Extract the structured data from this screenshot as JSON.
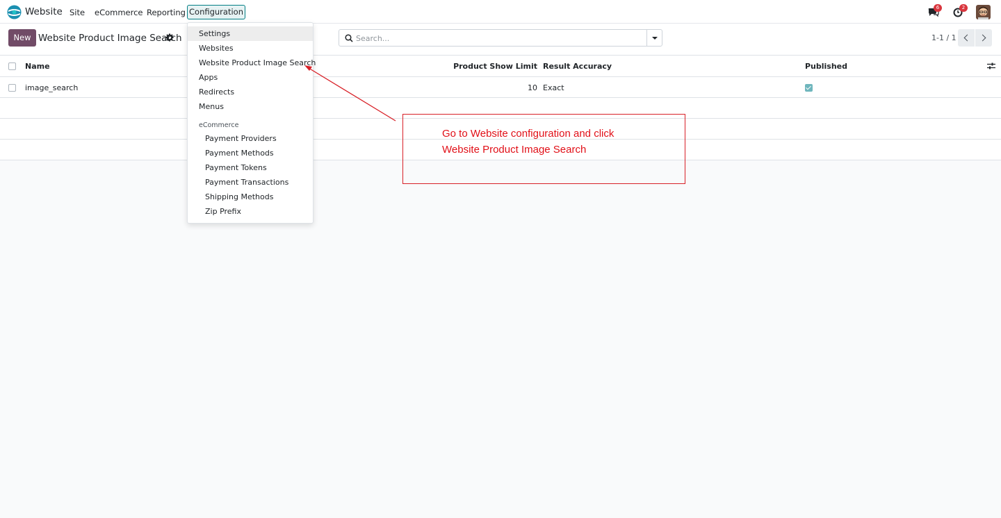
{
  "navbar": {
    "app_name": "Website",
    "menu": [
      "Site",
      "eCommerce",
      "Reporting"
    ],
    "config_label": "Configuration",
    "messages_badge": "6",
    "activities_badge": "2"
  },
  "control_panel": {
    "new_label": "New",
    "title": "Website Product Image Search",
    "search_placeholder": "Search...",
    "pager": "1-1 / 1"
  },
  "table": {
    "headers": {
      "name": "Name",
      "limit": "Product Show Limit",
      "accuracy": "Result Accuracy",
      "published": "Published"
    },
    "rows": [
      {
        "name": "image_search",
        "limit": "10",
        "accuracy": "Exact",
        "published": true
      }
    ]
  },
  "dropdown": {
    "items": [
      "Settings",
      "Websites",
      "Website Product Image Search",
      "Apps",
      "Redirects",
      "Menus"
    ],
    "section_header": "eCommerce",
    "sub_items": [
      "Payment Providers",
      "Payment Methods",
      "Payment Tokens",
      "Payment Transactions",
      "Shipping Methods",
      "Zip Prefix"
    ]
  },
  "annotation": {
    "line1": "Go to Website configuration and click",
    "line2": "Website Product Image Search"
  },
  "colors": {
    "brand": "#714b67",
    "accent": "#017e84",
    "annotation": "#e10f17",
    "badge": "#d9363e"
  }
}
